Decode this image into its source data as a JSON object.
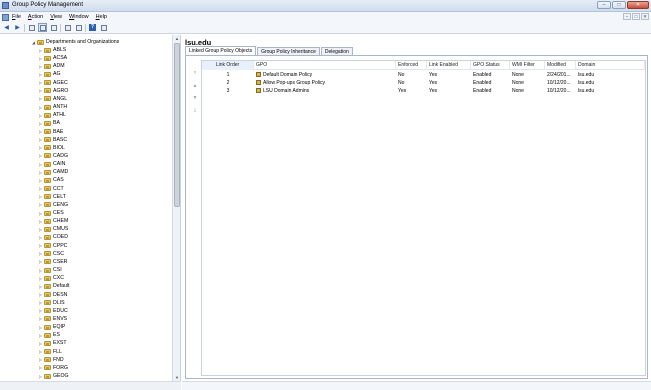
{
  "window": {
    "title": "Group Policy Management",
    "controls": [
      "–",
      "□",
      "✕"
    ]
  },
  "menu": {
    "items": [
      {
        "label": "File",
        "mnemonic": "F"
      },
      {
        "label": "Action",
        "mnemonic": "A"
      },
      {
        "label": "View",
        "mnemonic": "V"
      },
      {
        "label": "Window",
        "mnemonic": "W"
      },
      {
        "label": "Help",
        "mnemonic": "H"
      }
    ],
    "right_controls": [
      "–",
      "□",
      "✕"
    ]
  },
  "toolbar": {
    "back": "◀",
    "forward": "▶",
    "help": "?"
  },
  "tree": {
    "parent": "Departments and Organizations",
    "items": [
      "ABLS",
      "ACSA",
      "ADM",
      "AG",
      "AGEC",
      "AGRO",
      "ANGL",
      "ANTH",
      "ATHL",
      "BA",
      "BAE",
      "BASC",
      "BIOL",
      "CADG",
      "CAIN",
      "CAMD",
      "CAS",
      "CCT",
      "CELT",
      "CENG",
      "CES",
      "CHEM",
      "CMUS",
      "COED",
      "CPPC",
      "CSC",
      "CSER",
      "CSI",
      "CXC",
      "Default",
      "DESN",
      "DLIS",
      "EDUC",
      "ENVS",
      "EQIP",
      "ES",
      "EXST",
      "FLL",
      "FND",
      "FORG",
      "GEOG"
    ]
  },
  "right": {
    "domain_title": "lsu.edu",
    "tabs": [
      "Linked Group Policy Objects",
      "Group Policy Inheritance",
      "Delegation"
    ],
    "columns": [
      "Link Order",
      "GPO",
      "Enforced",
      "Link Enabled",
      "GPO Status",
      "WMI Filter",
      "Modified",
      "Domain"
    ],
    "rows": [
      {
        "order": "1",
        "gpo": "Default Domain Policy",
        "enforced": "No",
        "link_enabled": "Yes",
        "status": "Enabled",
        "wmi": "None",
        "modified": "2/24/201...",
        "domain": "lsu.edu"
      },
      {
        "order": "2",
        "gpo": "Allow Pop-ups Group Policy",
        "enforced": "No",
        "link_enabled": "Yes",
        "status": "Enabled",
        "wmi": "None",
        "modified": "10/12/20...",
        "domain": "lsu.edu"
      },
      {
        "order": "3",
        "gpo": "LSU Domain Admins",
        "enforced": "Yes",
        "link_enabled": "Yes",
        "status": "Enabled",
        "wmi": "None",
        "modified": "10/12/20...",
        "domain": "lsu.edu"
      }
    ],
    "order_buttons": [
      "⤒",
      "▲",
      "▼",
      "⤓"
    ]
  }
}
